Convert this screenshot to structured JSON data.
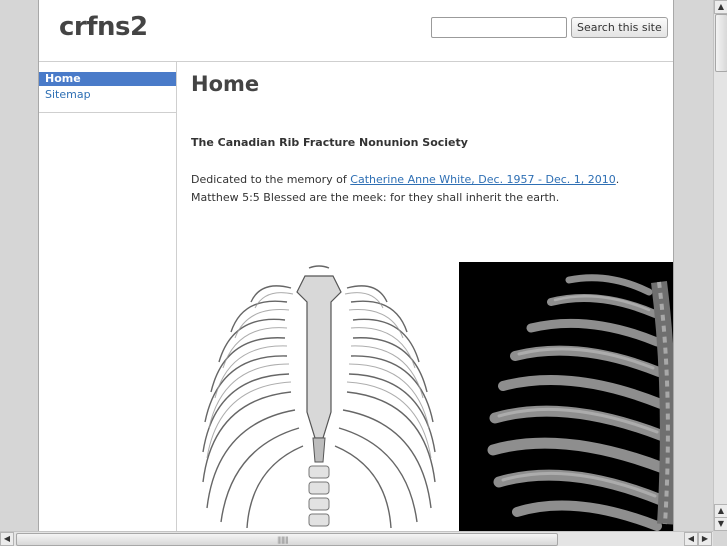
{
  "header": {
    "site_title": "crfns2",
    "search_placeholder": "",
    "search_button_label": "Search this site"
  },
  "sidebar": {
    "items": [
      {
        "label": "Home",
        "selected": true
      },
      {
        "label": "Sitemap",
        "selected": false
      }
    ]
  },
  "main": {
    "heading": "Home",
    "org_name": "The Canadian Rib Fracture Nonunion Society",
    "dedication_prefix": "Dedicated to the memory of ",
    "dedication_link": "Catherine Anne White, Dec. 1957 - Dec. 1, 2010",
    "dedication_suffix": ".",
    "verse": "Matthew 5:5 Blessed are the meek: for they shall inherit the earth."
  },
  "colors": {
    "nav_selected_bg": "#4a7bc9",
    "link": "#2e6fb4",
    "text": "#333333"
  }
}
